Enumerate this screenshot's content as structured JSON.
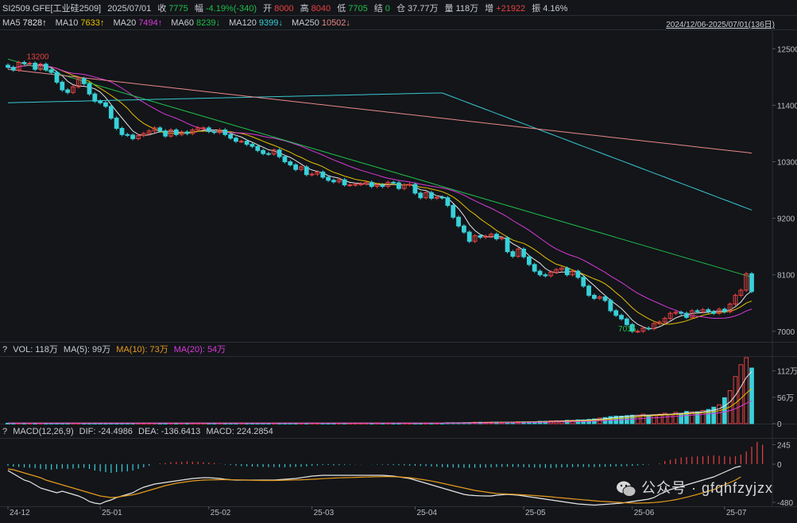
{
  "header": {
    "symbol": "SI2509.GFE[工业硅2509]",
    "date": "2025/07/01",
    "close_label": "收",
    "close_value": "7775",
    "change_label": "幅",
    "change_value": "-4.19%(-340)",
    "open_label": "开",
    "open_value": "8000",
    "high_label": "高",
    "high_value": "8040",
    "low_label": "低",
    "low_value": "7705",
    "settle_label": "结",
    "settle_value": "0",
    "oi_label": "仓",
    "oi_value": "37.77万",
    "vol_label": "量",
    "vol_value": "118万",
    "inc_label": "增",
    "inc_value": "+21922",
    "amp_label": "振",
    "amp_value": "4.16%"
  },
  "ma_bar": {
    "ma5_label": "MA5",
    "ma5_value": "7828↑",
    "ma10_label": "MA10",
    "ma10_value": "7633↑",
    "ma20_label": "MA20",
    "ma20_value": "7494↑",
    "ma60_label": "MA60",
    "ma60_value": "8239↓",
    "ma120_label": "MA120",
    "ma120_value": "9399↓",
    "ma250_label": "MA250",
    "ma250_value": "10502↓",
    "range": "2024/12/06-2025/07/01(136日)"
  },
  "vol_bar": {
    "prefix": "?",
    "vol": "VOL: 118万",
    "ma5": "MA(5): 99万",
    "ma10": "MA(10): 73万",
    "ma20": "MA(20): 54万"
  },
  "macd_bar": {
    "prefix": "?",
    "params": "MACD(12,26,9)",
    "dif": "DIF: -24.4986",
    "dea": "DEA: -136.6413",
    "macd": "MACD: 224.2854"
  },
  "colors": {
    "up": "#e84141",
    "down": "#38d0d8",
    "ma5": "#e6e6e6",
    "ma10": "#e5c000",
    "ma20": "#d83ad8",
    "ma60": "#1fbf4a",
    "ma120": "#38c8d0",
    "ma250": "#e88888",
    "dif": "#e6e6e6",
    "dea": "#e69a1c",
    "background": "#131519"
  },
  "watermark": "公众号 · gfqhfzyjzx",
  "chart_data": {
    "type": "candlestick",
    "price_axis": {
      "ticks": [
        7000,
        8100,
        9200,
        10300,
        11400,
        12500
      ],
      "ylim": [
        6950,
        12800
      ]
    },
    "vol_axis": {
      "ticks": [
        "0",
        "56万",
        "112万"
      ],
      "ylim": [
        0,
        140
      ]
    },
    "macd_axis": {
      "ticks": [
        "-480",
        "0",
        "245"
      ],
      "ylim": [
        -520,
        310
      ]
    },
    "x_labels": [
      "24-12",
      "25-01",
      "25-02",
      "25-03",
      "25-04",
      "25-05",
      "25-06",
      "25-07"
    ],
    "x_label_index": [
      0,
      17,
      37,
      56,
      75,
      95,
      115,
      132
    ],
    "annotations": [
      {
        "text": "13200",
        "i": 2
      },
      {
        "text": "7015",
        "i": 119
      }
    ],
    "close": [
      12140,
      12085,
      12235,
      12210,
      12220,
      12100,
      12200,
      12090,
      12040,
      11850,
      11700,
      11650,
      11760,
      11920,
      11820,
      11620,
      11480,
      11450,
      11380,
      11150,
      10950,
      10830,
      10820,
      10750,
      10810,
      10850,
      10900,
      10960,
      10900,
      10800,
      10920,
      10830,
      10880,
      10850,
      10920,
      10960,
      10960,
      10890,
      10870,
      10920,
      10830,
      10760,
      10700,
      10700,
      10640,
      10600,
      10520,
      10460,
      10450,
      10530,
      10400,
      10300,
      10240,
      10150,
      10200,
      10050,
      10060,
      10100,
      10000,
      9940,
      9910,
      9950,
      9850,
      9850,
      9860,
      9870,
      9900,
      9820,
      9850,
      9820,
      9900,
      9890,
      9780,
      9850,
      9860,
      9690,
      9600,
      9700,
      9590,
      9610,
      9600,
      9450,
      9220,
      9050,
      8930,
      8750,
      8860,
      8830,
      8850,
      8890,
      8800,
      8820,
      8550,
      8460,
      8600,
      8450,
      8300,
      8170,
      8100,
      8080,
      8150,
      8200,
      8230,
      8100,
      8170,
      8050,
      7880,
      7700,
      7640,
      7670,
      7600,
      7400,
      7310,
      7240,
      7130,
      7000,
      7000,
      7060,
      7050,
      7150,
      7180,
      7250,
      7350,
      7370,
      7350,
      7270,
      7400,
      7380,
      7420,
      7380,
      7350,
      7430,
      7380,
      7530,
      7700,
      7800,
      8120,
      7775
    ],
    "volume": [
      1,
      1,
      1,
      1,
      1,
      1,
      1,
      1,
      1,
      1,
      1,
      1,
      1,
      1,
      1,
      1,
      1,
      1,
      1,
      1,
      1,
      1,
      1,
      1,
      1,
      1,
      1,
      1,
      1,
      1,
      1,
      1,
      1,
      1,
      1,
      1,
      1,
      1,
      1,
      1,
      1,
      1,
      1,
      1,
      1,
      1,
      1,
      1,
      1,
      1,
      1,
      1,
      1,
      1,
      1,
      1,
      1,
      1,
      1,
      1,
      1,
      1,
      1,
      1,
      1,
      1,
      1,
      1,
      1,
      1,
      1,
      1,
      1,
      1,
      1,
      1,
      1,
      1,
      1,
      1,
      1,
      2,
      2,
      2,
      2,
      2,
      3,
      3,
      3,
      3,
      3,
      3,
      3,
      3,
      4,
      4,
      4,
      4,
      5,
      5,
      6,
      6,
      6,
      7,
      7,
      8,
      8,
      9,
      10,
      12,
      13,
      15,
      16,
      16,
      17,
      18,
      18,
      20,
      18,
      19,
      20,
      22,
      20,
      24,
      22,
      26,
      25,
      25,
      28,
      30,
      35,
      40,
      55,
      70,
      100,
      125,
      140,
      118
    ],
    "macd_hist": [
      -20,
      -30,
      -35,
      -40,
      -45,
      -50,
      -60,
      -65,
      -70,
      -60,
      -55,
      -60,
      -55,
      -50,
      -45,
      -60,
      -80,
      -90,
      -100,
      -110,
      -100,
      -95,
      -90,
      -80,
      -60,
      -40,
      -20,
      0,
      10,
      15,
      25,
      28,
      30,
      35,
      32,
      30,
      25,
      20,
      15,
      5,
      -5,
      -10,
      -18,
      -24,
      -26,
      -30,
      -32,
      -34,
      -36,
      -36,
      -38,
      -38,
      -36,
      -34,
      -32,
      -28,
      -20,
      -15,
      -10,
      -10,
      -15,
      -12,
      -8,
      -5,
      -3,
      -2,
      0,
      -2,
      -4,
      -6,
      -8,
      -10,
      -12,
      -14,
      -18,
      -20,
      -22,
      -24,
      -28,
      -32,
      -36,
      -40,
      -42,
      -44,
      -46,
      -46,
      -45,
      -44,
      -42,
      -40,
      -36,
      -34,
      -32,
      -34,
      -36,
      -38,
      -40,
      -42,
      -44,
      -46,
      -48,
      -44,
      -40,
      -38,
      -36,
      -34,
      -34,
      -36,
      -36,
      -34,
      -32,
      -30,
      -28,
      -26,
      -24,
      -20,
      -15,
      -10,
      -5,
      0,
      10,
      40,
      55,
      70,
      85,
      90,
      95,
      98,
      100,
      105,
      110,
      105,
      100,
      95,
      100,
      120,
      160,
      220,
      280,
      245
    ],
    "dif": [
      -80,
      -120,
      -160,
      -200,
      -220,
      -260,
      -300,
      -320,
      -340,
      -360,
      -340,
      -360,
      -380,
      -400,
      -430,
      -470,
      -490,
      -500,
      -470,
      -450,
      -420,
      -400,
      -380,
      -360,
      -320,
      -290,
      -270,
      -250,
      -240,
      -230,
      -220,
      -210,
      -200,
      -190,
      -180,
      -175,
      -170,
      -170,
      -175,
      -180,
      -190,
      -195,
      -200,
      -200,
      -200,
      -200,
      -200,
      -200,
      -200,
      -200,
      -195,
      -190,
      -185,
      -180,
      -170,
      -160,
      -150,
      -145,
      -140,
      -140,
      -140,
      -140,
      -140,
      -140,
      -140,
      -140,
      -140,
      -140,
      -140,
      -140,
      -145,
      -150,
      -160,
      -170,
      -180,
      -200,
      -220,
      -240,
      -260,
      -280,
      -300,
      -320,
      -340,
      -360,
      -380,
      -390,
      -395,
      -398,
      -400,
      -400,
      -390,
      -385,
      -380,
      -385,
      -390,
      -400,
      -410,
      -420,
      -430,
      -440,
      -450,
      -460,
      -470,
      -480,
      -490,
      -500,
      -505,
      -510,
      -515,
      -510,
      -505,
      -500,
      -495,
      -490,
      -480,
      -470,
      -460,
      -450,
      -440,
      -420,
      -380,
      -350,
      -320,
      -300,
      -280,
      -260,
      -240,
      -220,
      -200,
      -180,
      -160,
      -130,
      -100,
      -70,
      -40,
      -25
    ],
    "dea": [
      -60,
      -70,
      -90,
      -110,
      -130,
      -150,
      -170,
      -200,
      -220,
      -240,
      -260,
      -280,
      -300,
      -320,
      -340,
      -360,
      -380,
      -400,
      -410,
      -420,
      -415,
      -405,
      -395,
      -385,
      -370,
      -350,
      -330,
      -310,
      -290,
      -270,
      -255,
      -240,
      -230,
      -220,
      -210,
      -205,
      -200,
      -198,
      -196,
      -195,
      -195,
      -196,
      -197,
      -198,
      -200,
      -202,
      -204,
      -205,
      -205,
      -205,
      -204,
      -202,
      -200,
      -198,
      -196,
      -194,
      -190,
      -186,
      -182,
      -178,
      -175,
      -172,
      -170,
      -168,
      -166,
      -164,
      -162,
      -160,
      -158,
      -156,
      -156,
      -158,
      -160,
      -165,
      -170,
      -180,
      -190,
      -200,
      -212,
      -225,
      -240,
      -255,
      -270,
      -285,
      -300,
      -315,
      -330,
      -340,
      -350,
      -360,
      -368,
      -372,
      -375,
      -378,
      -382,
      -386,
      -390,
      -395,
      -400,
      -405,
      -410,
      -418,
      -424,
      -430,
      -436,
      -442,
      -448,
      -454,
      -460,
      -466,
      -470,
      -474,
      -478,
      -482,
      -486,
      -488,
      -490,
      -488,
      -486,
      -482,
      -476,
      -468,
      -458,
      -446,
      -432,
      -416,
      -398,
      -380,
      -360,
      -340,
      -320,
      -290,
      -260,
      -230,
      -200,
      -160
    ]
  }
}
